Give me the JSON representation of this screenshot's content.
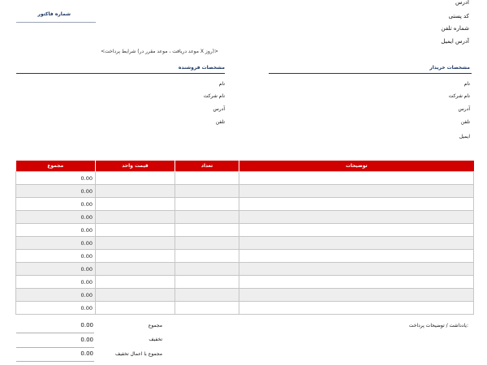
{
  "buyer_contact_top": {
    "address": "آدرس",
    "postal_code": "کد پستی",
    "phone": "شماره تلفن",
    "email": "آدرس ایمیل"
  },
  "invoice_number_label": "شماره فاکتور",
  "payment_terms": "<شرایط پرداخت (موعد دریافت ، موعد مقرر در X روز)>",
  "seller": {
    "heading": "مشخصات فروشنده",
    "fields": [
      "نام",
      "نام شرکت",
      "آدرس",
      "تلفن"
    ]
  },
  "buyer": {
    "heading": "مشخصات خریدار",
    "fields": [
      "نام",
      "نام شرکت",
      "آدرس",
      "تلفن",
      "ایمیل"
    ]
  },
  "table": {
    "headers": {
      "description": "توضیحات",
      "quantity": "تعداد",
      "unit_price": "قیمت واحد",
      "total": "مجموع"
    },
    "rows": [
      {
        "total": "0.00"
      },
      {
        "total": "0.00"
      },
      {
        "total": "0.00"
      },
      {
        "total": "0.00"
      },
      {
        "total": "0.00"
      },
      {
        "total": "0.00"
      },
      {
        "total": "0.00"
      },
      {
        "total": "0.00"
      },
      {
        "total": "0.00"
      },
      {
        "total": "0.00"
      },
      {
        "total": "0.00"
      }
    ]
  },
  "summary": {
    "subtotal_label": "مجموع",
    "subtotal_value": "0.00",
    "discount_label": "تخفیف",
    "discount_value": "0.00",
    "total_after_discount_label": "مجموع با اعمال تخفیف",
    "total_after_discount_value": "0.00"
  },
  "notes_label": "یادداشت / توضیحات پرداخت:",
  "colors": {
    "header_red": "#d00000",
    "heading_navy": "#1f3864",
    "rule": "#1f3864",
    "row_alt": "#eeeeee"
  }
}
